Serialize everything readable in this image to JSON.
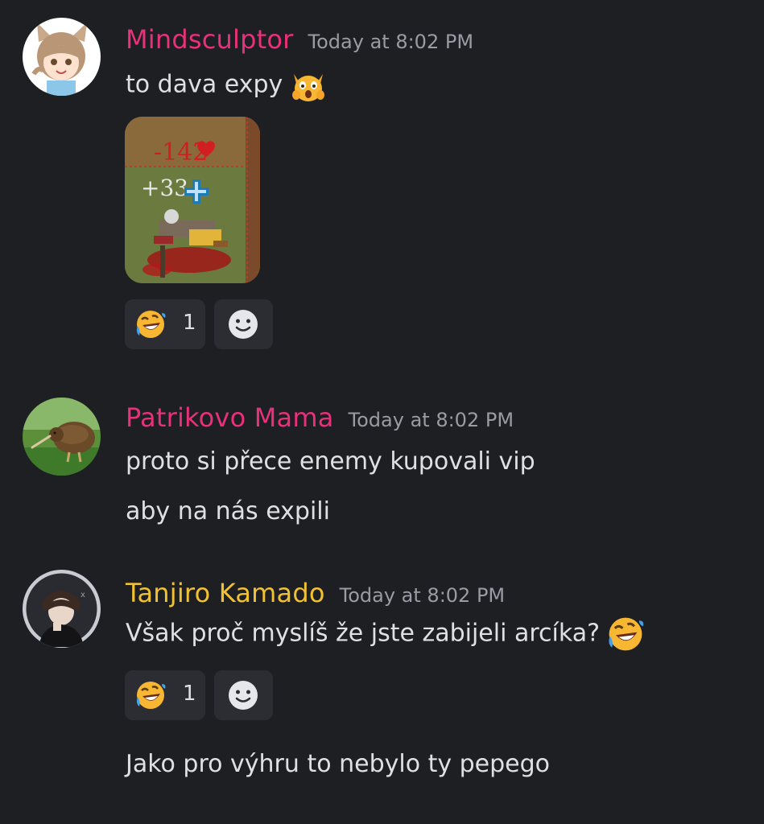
{
  "messages": [
    {
      "author": "Mindsculptor",
      "author_color": "#e9307a",
      "timestamp": "Today at 8:02 PM",
      "text": "to dava expy",
      "text_emoji": "scream-cat-emoji",
      "attachment": {
        "labels": {
          "damage": "-142",
          "heal": "+33"
        },
        "icons": [
          "heart-icon",
          "plus-cross-icon"
        ]
      },
      "reaction": {
        "emoji": "rolling-on-the-floor-laughing-emoji",
        "count": "1"
      }
    },
    {
      "author": "Patrikovo Mama",
      "author_color": "#e9307a",
      "timestamp": "Today at 8:02 PM",
      "lines": [
        "proto si přece enemy kupovali vip",
        "aby na nás expili"
      ]
    },
    {
      "author": "Tanjiro Kamado",
      "author_color": "#f0c233",
      "timestamp": "Today at 8:02 PM",
      "text": "Však proč myslíš že jste zabijeli arcíka?",
      "text_emoji": "rolling-on-the-floor-laughing-emoji",
      "reaction": {
        "emoji": "rolling-on-the-floor-laughing-emoji",
        "count": "1"
      },
      "followup": "Jako pro výhru to nebylo ty pepego"
    }
  ],
  "colors": {
    "background": "#1e1f23",
    "reaction_bg": "#2c2d33",
    "timestamp": "#9a9ba3",
    "text": "#dfe0e4"
  }
}
